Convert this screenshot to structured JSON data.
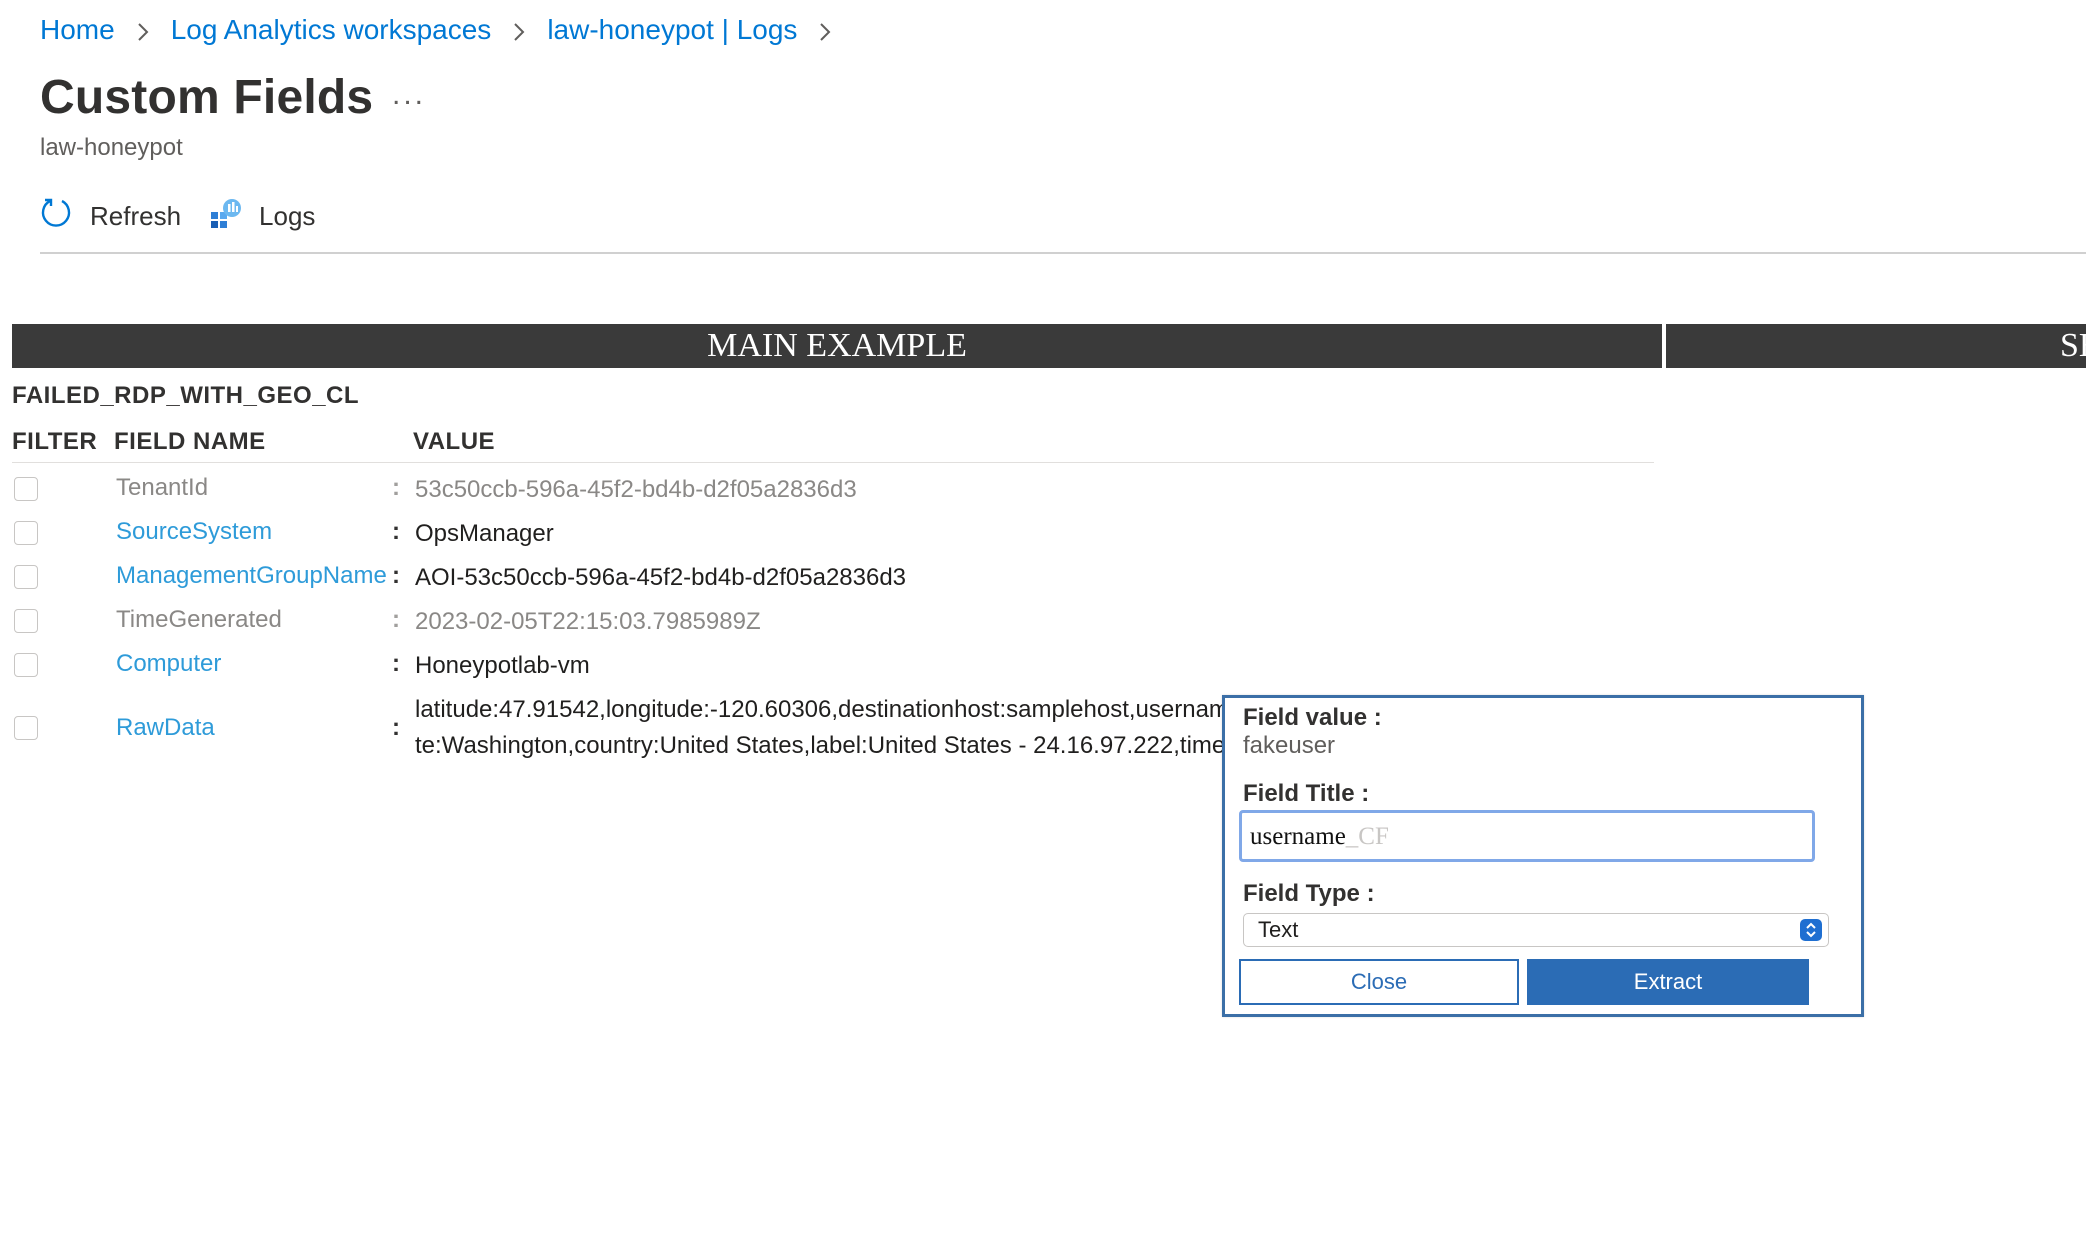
{
  "breadcrumb": {
    "items": [
      "Home",
      "Log Analytics workspaces",
      "law-honeypot | Logs"
    ]
  },
  "header": {
    "title": "Custom Fields",
    "more": "...",
    "subtitle": "law-honeypot"
  },
  "toolbar": {
    "refresh_label": "Refresh",
    "logs_label": "Logs"
  },
  "bands": {
    "main_label": "MAIN EXAMPLE",
    "second_label": "SE"
  },
  "table": {
    "name": "FAILED_RDP_WITH_GEO_CL",
    "columns": [
      "FILTER",
      "FIELD NAME",
      "VALUE"
    ],
    "rows": [
      {
        "name": "TenantId",
        "value": "53c50ccb-596a-45f2-bd4b-d2f05a2836d3"
      },
      {
        "name": "SourceSystem",
        "value": "OpsManager"
      },
      {
        "name": "ManagementGroupName",
        "value": "AOI-53c50ccb-596a-45f2-bd4b-d2f05a2836d3"
      },
      {
        "name": "TimeGenerated",
        "value": "2023-02-05T22:15:03.7985989Z"
      },
      {
        "name": "Computer",
        "value": "Honeypotlab-vm"
      },
      {
        "name": "RawData",
        "line1": "latitude:47.91542,longitude:-120.60306,destinationhost:samplehost,usernam",
        "line2": "te:Washington,country:United States,label:United States - 24.16.97.222,time"
      }
    ]
  },
  "popup": {
    "value_label": "Field value :",
    "value": "fakeuser",
    "title_label": "Field Title :",
    "title_value": "username",
    "title_suffix": "_CF",
    "type_label": "Field Type :",
    "type_value": "Text",
    "close_label": "Close",
    "extract_label": "Extract"
  },
  "colors": {
    "link": "#0078d4",
    "field_link": "#2e9bd9",
    "band": "#3a3a3a",
    "popup_border": "#3b6fa7",
    "primary_button": "#2b6cb5"
  }
}
